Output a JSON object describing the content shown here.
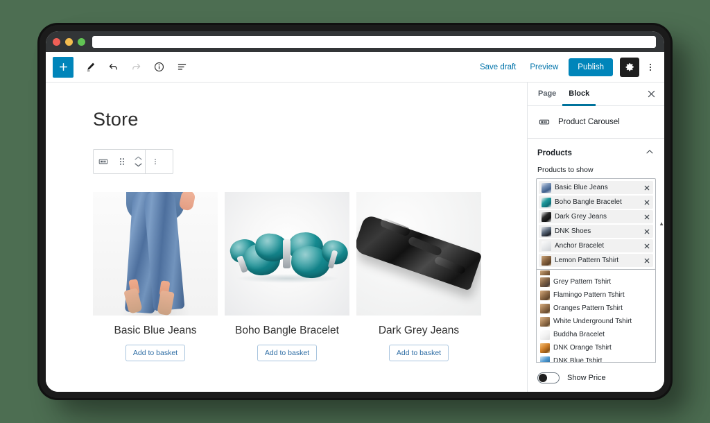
{
  "browser": {
    "url_value": "",
    "url_placeholder": ""
  },
  "toolbar": {
    "add_block_label": "+",
    "icons": [
      {
        "name": "pen-icon",
        "label": "Edit"
      },
      {
        "name": "undo-icon",
        "label": "Undo"
      },
      {
        "name": "redo-icon",
        "label": "Redo"
      },
      {
        "name": "info-icon",
        "label": "Content structure"
      },
      {
        "name": "list-view-icon",
        "label": "Block navigation"
      }
    ],
    "save_draft_label": "Save draft",
    "preview_label": "Preview",
    "publish_label": "Publish",
    "settings_icon": "gear-icon",
    "more_icon": "vertical-ellipsis-icon"
  },
  "block_toolbar": {
    "block_icon": "product-carousel-icon",
    "drag_icon": "drag-handle-icon",
    "move_up_icon": "chevron-up-icon",
    "move_down_icon": "chevron-down-icon",
    "more_icon": "vertical-ellipsis-icon"
  },
  "canvas": {
    "page_title": "Store",
    "products": [
      {
        "name": "Basic Blue Jeans",
        "button_label": "Add to basket",
        "image_name": "basic-blue-jeans-photo"
      },
      {
        "name": "Boho Bangle Bracelet",
        "button_label": "Add to basket",
        "image_name": "boho-bangle-bracelet-photo"
      },
      {
        "name": "Dark Grey Jeans",
        "button_label": "Add to basket",
        "image_name": "dark-grey-jeans-photo"
      }
    ]
  },
  "sidebar": {
    "tabs": [
      {
        "label": "Page",
        "active": false
      },
      {
        "label": "Block",
        "active": true
      }
    ],
    "close_icon": "close-icon",
    "block_card": {
      "icon": "product-carousel-icon",
      "title": "Product Carousel"
    },
    "products_panel": {
      "title": "Products",
      "chevron": "chevron-up-icon",
      "field_label": "Products to show",
      "selected": [
        {
          "label": "Basic Blue Jeans",
          "thumb": "thumb-jeans",
          "remove_icon": "close-icon"
        },
        {
          "label": "Boho Bangle Bracelet",
          "thumb": "thumb-boho",
          "remove_icon": "close-icon"
        },
        {
          "label": "Dark Grey Jeans",
          "thumb": "thumb-dark",
          "remove_icon": "close-icon"
        },
        {
          "label": "DNK Shoes",
          "thumb": "thumb-shoes",
          "remove_icon": "close-icon"
        },
        {
          "label": "Anchor Bracelet",
          "thumb": "thumb-anchor",
          "remove_icon": "close-icon"
        },
        {
          "label": "Lemon Pattern Tshirt",
          "thumb": "thumb-tshirt-lemon",
          "remove_icon": "close-icon"
        }
      ],
      "scroll_up_indicator": "▲",
      "suggestions": [
        {
          "label": "Grey Pattern Tshirt",
          "thumb": "thumb-tshirt-grey"
        },
        {
          "label": "Flamingo Pattern Tshirt",
          "thumb": "thumb-tshirt-flam"
        },
        {
          "label": "Oranges Pattern Tshirt",
          "thumb": "thumb-tshirt-orange"
        },
        {
          "label": "White Underground Tshirt",
          "thumb": "thumb-tshirt-white"
        },
        {
          "label": "Buddha Bracelet",
          "thumb": "thumb-buddha"
        },
        {
          "label": "DNK Orange Tshirt",
          "thumb": "thumb-dnk-orange"
        },
        {
          "label": "DNK Blue Tshirt",
          "thumb": "thumb-dnk-blue"
        }
      ]
    },
    "show_price": {
      "label": "Show Price",
      "enabled": false
    }
  },
  "colors": {
    "accent_blue": "#0085ba",
    "link_blue": "#0073aa",
    "tab_underline": "#00739c",
    "background_green": "#4d6e52",
    "chrome_dark": "#323537",
    "traffic_red": "#ef5f56",
    "traffic_yellow": "#f5bd4f",
    "traffic_green": "#61c454"
  }
}
